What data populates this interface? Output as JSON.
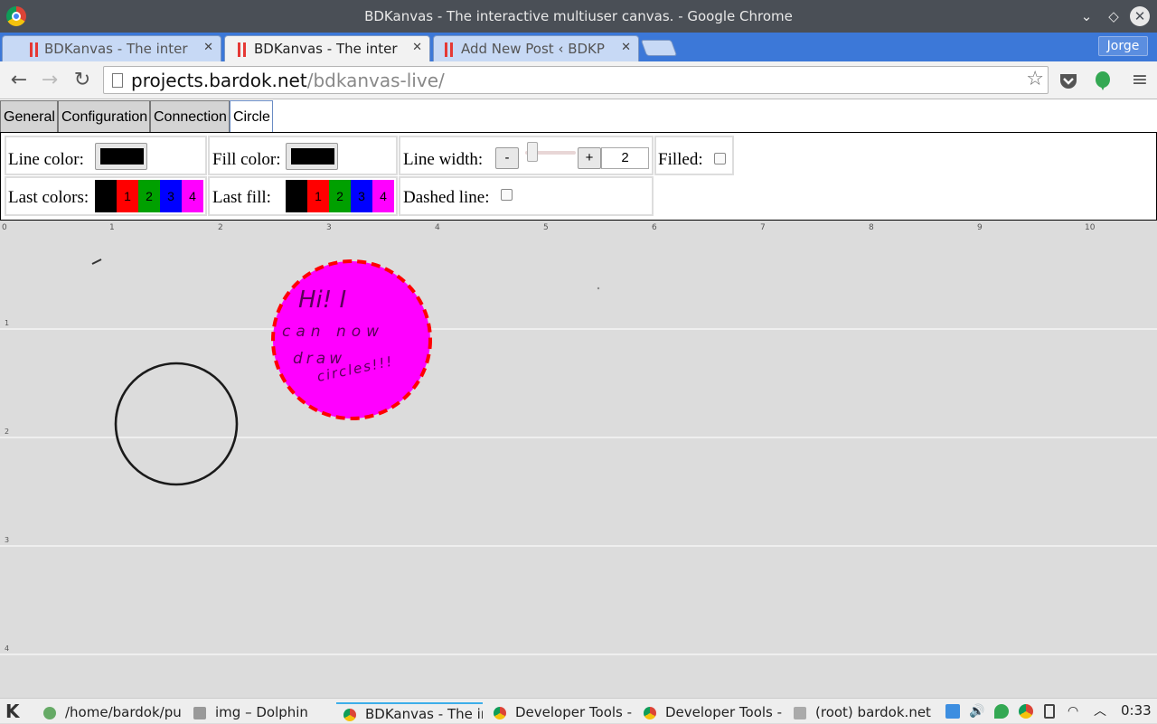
{
  "window": {
    "title": "BDKanvas - The interactive multiuser canvas. - Google Chrome"
  },
  "tabs": [
    {
      "label": "BDKanvas - The inter",
      "active": false
    },
    {
      "label": "BDKanvas - The inter",
      "active": true
    },
    {
      "label": "Add New Post ‹ BDKP",
      "active": false
    }
  ],
  "profile": {
    "name": "Jorge"
  },
  "address": {
    "host": "projects.bardok.net",
    "path": "/bdkanvas-live/"
  },
  "app_tabs": [
    "General",
    "Configuration",
    "Connection",
    "Circle"
  ],
  "options": {
    "line_color_label": "Line color:",
    "fill_color_label": "Fill color:",
    "line_width_label": "Line width:",
    "minus": "-",
    "plus": "+",
    "line_width_value": "2",
    "filled_label": "Filled:",
    "last_colors_label": "Last colors:",
    "last_fill_label": "Last fill:",
    "dashed_label": "Dashed line:",
    "swatch_labels": [
      "",
      "1",
      "2",
      "3",
      "4"
    ],
    "swatch_colors": [
      "#000000",
      "#ff0000",
      "#00a000",
      "#0000ff",
      "#ff00ff"
    ],
    "line_width_slider": 0.0
  },
  "canvas": {
    "x_ticks": [
      "0",
      "1",
      "2",
      "3",
      "4",
      "5",
      "6",
      "7",
      "8",
      "9",
      "10"
    ],
    "y_ticks": [
      "1",
      "2",
      "3",
      "4"
    ],
    "handwriting": [
      "Hi! I",
      "can now",
      "draw",
      "circles!!!"
    ],
    "circle_fill": "#ff00ff",
    "circle_stroke": "#ff0000"
  },
  "taskbar": {
    "items": [
      {
        "label": "/home/bardok/pu",
        "icon": "terminal-icon"
      },
      {
        "label": "img – Dolphin",
        "icon": "folder-icon"
      },
      {
        "label": "BDKanvas - The in",
        "icon": "chrome-icon",
        "active": true
      },
      {
        "label": "Developer Tools -",
        "icon": "chrome-icon"
      },
      {
        "label": "Developer Tools -",
        "icon": "chrome-icon"
      },
      {
        "label": "(root) bardok.net",
        "icon": "terminal-icon"
      }
    ],
    "clock": "0:33"
  }
}
